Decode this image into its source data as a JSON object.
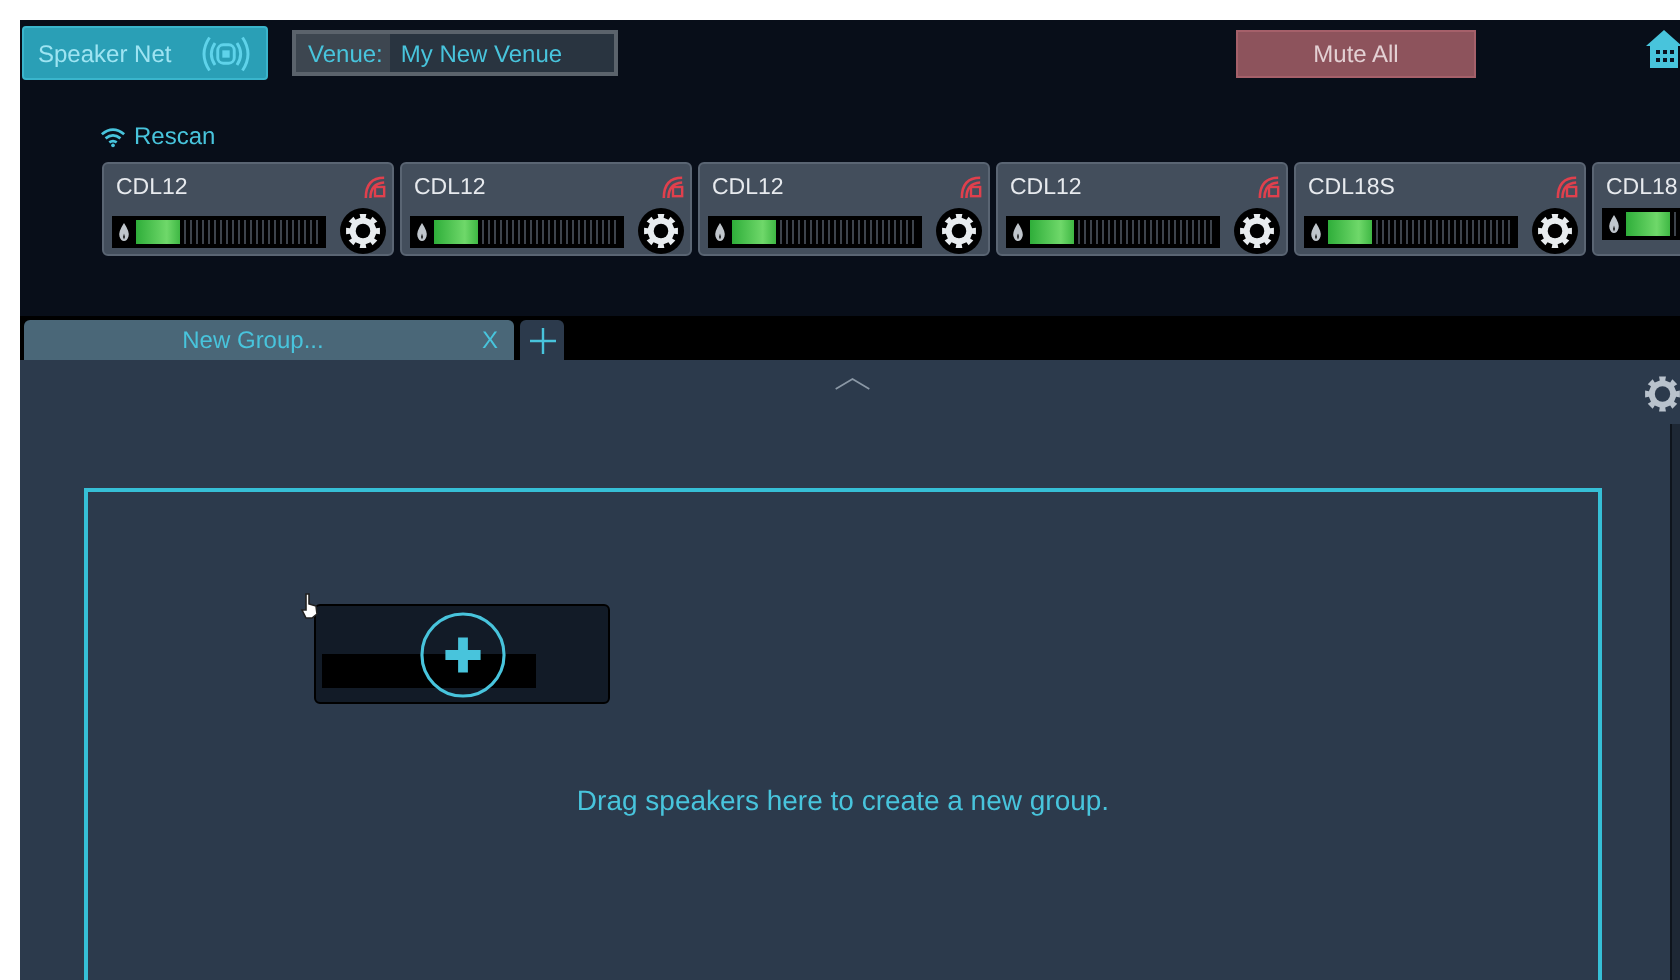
{
  "header": {
    "speaker_net_button": "Speaker Net",
    "venue": {
      "label": "Venue:",
      "value": "My New Venue"
    },
    "mute_all_button": "Mute All"
  },
  "rescan": "Rescan",
  "speakers": [
    {
      "name": "CDL12",
      "level": 0.24
    },
    {
      "name": "CDL12",
      "level": 0.24
    },
    {
      "name": "CDL12",
      "level": 0.24
    },
    {
      "name": "CDL12",
      "level": 0.24
    },
    {
      "name": "CDL18S",
      "level": 0.24
    },
    {
      "name": "CDL18",
      "level": 0.24,
      "kind": "partial"
    }
  ],
  "tabs": [
    {
      "label": "New Group...",
      "close": "X",
      "selected": true
    }
  ],
  "drop_zone": {
    "message": "Drag speakers here to create a new group."
  }
}
